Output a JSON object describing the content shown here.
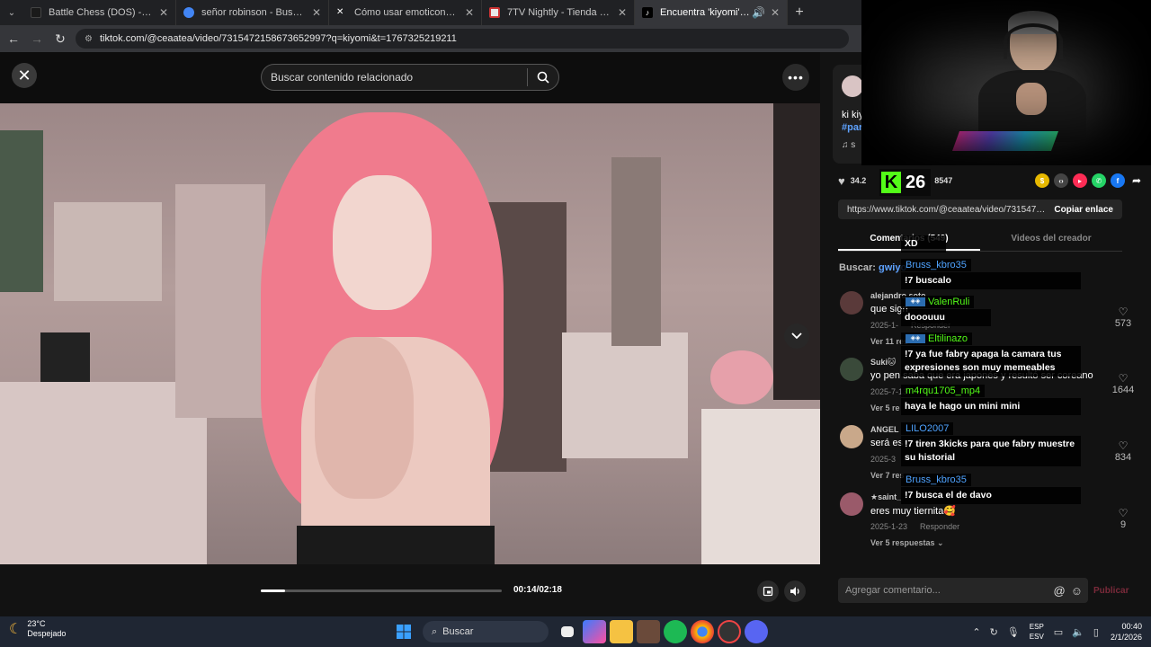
{
  "browser": {
    "tabs": [
      {
        "title": "Battle Chess (DOS) - online gam",
        "favicon_color": "#1a1a1a",
        "active": false
      },
      {
        "title": "señor robinson - Buscar con Go",
        "favicon_color": "#4285f4",
        "active": false
      },
      {
        "title": "Cómo usar emoticonos en el ch",
        "favicon_color": "#ffffff",
        "active": false
      },
      {
        "title": "7TV Nightly - Tienda web de C",
        "favicon_color": "#e8e8e8",
        "active": false
      },
      {
        "title": "Encuentra 'kiyomi' en TikTok",
        "favicon_color": "#000000",
        "active": true
      }
    ],
    "url": "tiktok.com/@ceaatea/video/7315472158673652997?q=kiyomi&t=1767325219211"
  },
  "search": {
    "placeholder": "Buscar contenido relacionado"
  },
  "video": {
    "time": "00:14/02:18",
    "progress": 0.1
  },
  "panel": {
    "description": "ki kiy",
    "hashtag": "#par",
    "music": "♫ s",
    "likes": "34.2",
    "saves": "8547",
    "share_link": "https://www.tiktok.com/@ceaatea/video/73154721...",
    "copy_label": "Copiar enlace",
    "tabs": [
      {
        "label": "Comentarios (549)",
        "active": true
      },
      {
        "label": "Videos del creador",
        "active": false
      }
    ],
    "search_hint_prefix": "Buscar:",
    "search_hint_term": "gwiyo"
  },
  "comments": [
    {
      "user": "alejandro soto",
      "text": "que sign",
      "date": "2025-1-",
      "reply": "Responder",
      "likes": "573",
      "more": "Ver 11 res",
      "avatar_color": "#5a3a3a"
    },
    {
      "user": "Suki🐱",
      "text": "yo pen saba que era japonés y resultó ser coreano",
      "date": "2025-7-13",
      "reply": "",
      "likes": "1644",
      "more": "Ver 5 re",
      "avatar_color": "#3a4a3a"
    },
    {
      "user": "ANGEL",
      "text": "será es",
      "date": "2025-3",
      "reply": "",
      "likes": "834",
      "more": "Ver 7 res",
      "avatar_color": "#c9a88a"
    },
    {
      "user": "★saint_",
      "text": "eres muy tiernita🥰",
      "date": "2025-1-23",
      "reply": "Responder",
      "likes": "9",
      "more": "Ver 5 respuestas ⌄",
      "avatar_color": "#9a5a6a"
    }
  ],
  "comment_box": {
    "placeholder": "Agregar comentario...",
    "publish": "Publicar"
  },
  "kick": {
    "count": "26",
    "brand_color": "#53fc18"
  },
  "chat": [
    {
      "user": "",
      "text": "XD",
      "user_color": "#ffffff"
    },
    {
      "user": "Bruss_kbro35",
      "text": "!7 buscalo",
      "user_color": "#4fa3ff"
    },
    {
      "user": "ValenRuli",
      "text": "dooouuu",
      "user_color": "#53fc18"
    },
    {
      "user": "Eltilinazo",
      "text": "!7 ya fue fabry apaga la camara tus expresiones son muy memeables",
      "user_color": "#53fc18"
    },
    {
      "user": "m4rqu1705_mp4",
      "text": "haya le hago un mini mini",
      "user_color": "#53fc18"
    },
    {
      "user": "LILO2007",
      "text": "!7 tiren 3kicks para que fabry muestre su historial",
      "user_color": "#4fa3ff"
    },
    {
      "user": "Bruss_kbro35",
      "text": "!7 busca el de davo",
      "user_color": "#4fa3ff"
    }
  ],
  "taskbar": {
    "temp": "23°C",
    "weather": "Despejado",
    "search": "Buscar",
    "lang1": "ESP",
    "lang2": "ESV",
    "time": "00:40",
    "date": "2/1/2026"
  }
}
